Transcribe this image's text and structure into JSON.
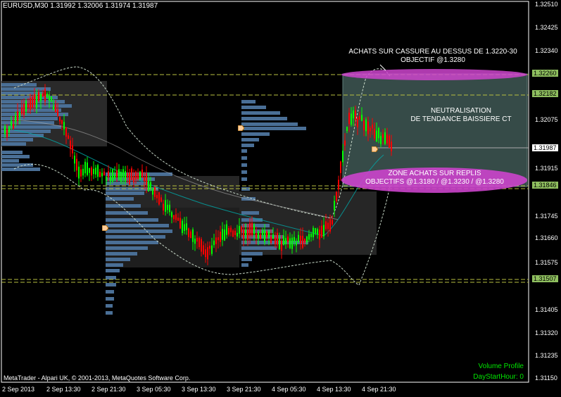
{
  "header": {
    "symbol_line": "EURUSD,M30  1.31992 1.32006 1.31974 1.31987"
  },
  "footer": {
    "copyright": "MetaTrader - Alpari UK, © 2001-2013, MetaQuotes Software Corp."
  },
  "indicator": {
    "name": "Volume Profile",
    "param": "DayStartHour: 0"
  },
  "annotations": {
    "buy_breakout_line1": "ACHATS SUR CASSURE AU DESSUS DE 1.3220-30",
    "buy_breakout_line2": "OBJECTIF @1.3280",
    "neutral_line1": "NEUTRALISATION",
    "neutral_line2": "DE TENDANCE BAISSIERE CT",
    "pullback_line1": "ZONE ACHATS SUR REPLIS",
    "pullback_line2": "OBJECTIFS @1.3180 / @1.3230 / @1.3280"
  },
  "price_axis": {
    "ticks": [
      "1.32510",
      "1.32425",
      "1.32340",
      "1.32260",
      "1.32182",
      "1.32075",
      "1.31987",
      "1.31915",
      "1.31846",
      "1.31745",
      "1.31660",
      "1.31575",
      "1.31507",
      "1.31405",
      "1.31320",
      "1.31235",
      "1.31150"
    ],
    "highlighted": {
      "1.32260": "#8fbf5f",
      "1.32182": "#8fbf5f",
      "1.31846": "#8fbf5f",
      "1.31507": "#8fbf5f",
      "1.31987": "#ffffff"
    }
  },
  "time_axis": {
    "labels": [
      "2 Sep 2013",
      "2 Sep 13:30",
      "2 Sep 21:30",
      "3 Sep 05:30",
      "3 Sep 13:30",
      "3 Sep 21:30",
      "4 Sep 05:30",
      "4 Sep 13:30",
      "4 Sep 21:30"
    ]
  },
  "colors": {
    "background": "#000000",
    "bull_candle": "#00ff00",
    "bear_candle": "#ff0000",
    "volume_profile": "#4a6f96",
    "neutral_zone": "#3c5350",
    "ellipse": "#cc44cc",
    "level_line": "#b8c040"
  }
}
